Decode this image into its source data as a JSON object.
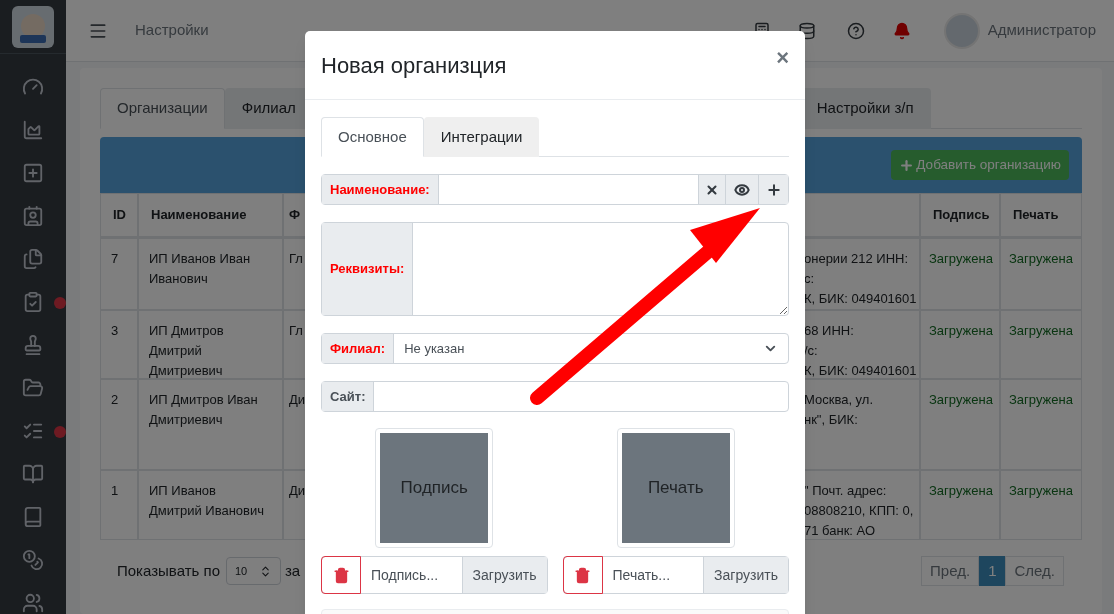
{
  "sidebar": {
    "items": [
      {
        "notification": false
      },
      {
        "notification": false
      },
      {
        "notification": false
      },
      {
        "notification": false
      },
      {
        "notification": false
      },
      {
        "notification": true
      },
      {
        "notification": false
      },
      {
        "notification": false
      },
      {
        "notification": true
      },
      {
        "notification": false
      },
      {
        "notification": false
      },
      {
        "notification": false
      },
      {
        "notification": false
      }
    ]
  },
  "topbar": {
    "title": "Настройки",
    "user": "Администратор"
  },
  "page_tabs": [
    {
      "label": "Организации",
      "selected": true
    },
    {
      "label": "Филиал",
      "selected": false
    },
    {
      "label": "Настройки з/п",
      "selected": false
    }
  ],
  "add_button": "Добавить организацию",
  "table": {
    "columns": [
      "ID",
      "Наименование",
      "Ф",
      "Подпись",
      "Печать"
    ],
    "rows": [
      {
        "id": "7",
        "name": "ИП Иванов Иван Иванович",
        "column_3": "Гл",
        "column_4": [
          "онерии 212 ИНН:",
          "с:",
          "К, БИК: 049401601"
        ],
        "signature": "Загружена",
        "seal": "Загружена"
      },
      {
        "id": "3",
        "name": "ИП Дмитров Дмитрий Дмитриевич",
        "column_3": "Гл",
        "column_4": [
          "68 ИНН:",
          "/с:",
          "К, БИК: 049401601"
        ],
        "signature": "Загружена",
        "seal": "Загружена"
      },
      {
        "id": "2",
        "name": "ИП Дмитров Иван Дмитриевич",
        "column_3": "Ди",
        "column_4": [
          "Москва, ул.",
          "нк\", БИК:"
        ],
        "signature": "Загружена",
        "seal": "Загружена"
      },
      {
        "id": "1",
        "name": "ИП Иванов Дмитрий Иванович",
        "column_3": "Ди",
        "column_4": [
          "\" Почт. адрес:",
          "08808210, КПП: 0,",
          "71 банк: АО"
        ],
        "signature": "Загружена",
        "seal": "Загружена"
      }
    ]
  },
  "footer": {
    "page_size_label": "Показывать по",
    "page_size": "10",
    "after_label": "за"
  },
  "pagination": [
    {
      "label": "Пред.",
      "selected": false
    },
    {
      "label": "1",
      "selected": true
    },
    {
      "label": "След.",
      "selected": false
    }
  ],
  "modal": {
    "title": "Новая организция",
    "close": "×",
    "tabs": [
      {
        "label": "Основное",
        "selected": true
      },
      {
        "label": "Интеграции",
        "selected": false
      }
    ],
    "fields": [
      {
        "kind": "input_actions",
        "label": "Наименование:",
        "required": true
      },
      {
        "kind": "textarea",
        "label": "Реквизиты:",
        "required": true
      },
      {
        "kind": "select",
        "label": "Филиал:",
        "required": true,
        "value": "Не указан"
      },
      {
        "kind": "input",
        "label": "Сайт:",
        "required": false
      }
    ],
    "images": [
      {
        "caption": "Подпись",
        "file": "Подпись...",
        "button": "Загрузить"
      },
      {
        "caption": "Печать",
        "file": "Печать...",
        "button": "Загрузить"
      }
    ]
  }
}
